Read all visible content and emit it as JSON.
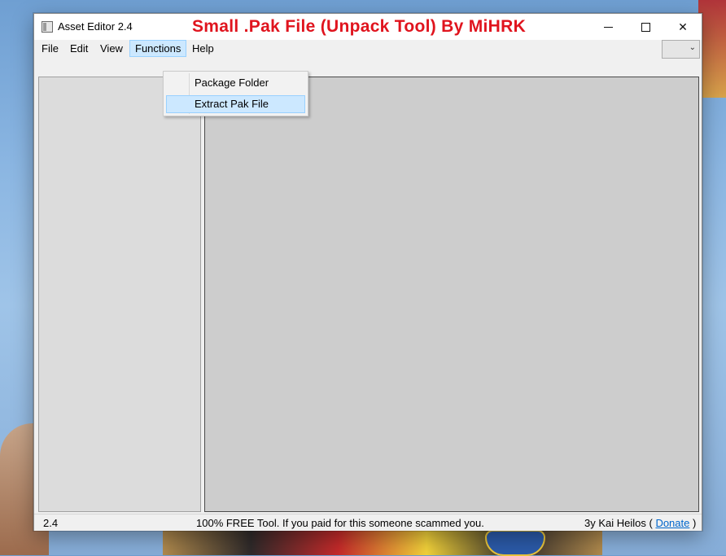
{
  "window": {
    "title": "Asset Editor 2.4",
    "overlay_banner": "Small .Pak File (Unpack Tool) By MiHRK",
    "banner_color": "#e0141e"
  },
  "controls": {
    "minimize": "minimize-icon",
    "maximize": "maximize-icon",
    "close": "✕"
  },
  "menu": {
    "items": [
      "File",
      "Edit",
      "View",
      "Functions",
      "Help"
    ],
    "active": "Functions"
  },
  "functions_menu": {
    "items": [
      "Package Folder",
      "Extract Pak File"
    ],
    "highlighted": "Extract Pak File"
  },
  "combo": {
    "value": "",
    "icon": "chevron-down-icon"
  },
  "status": {
    "version": "2.4",
    "message": "100% FREE Tool. If you paid for this someone scammed you.",
    "credit_prefix": "3y Kai Heilos (",
    "donate_link": "Donate",
    "credit_suffix": ")"
  },
  "colors": {
    "menu_highlight": "#cce8ff",
    "link": "#0066cc"
  }
}
